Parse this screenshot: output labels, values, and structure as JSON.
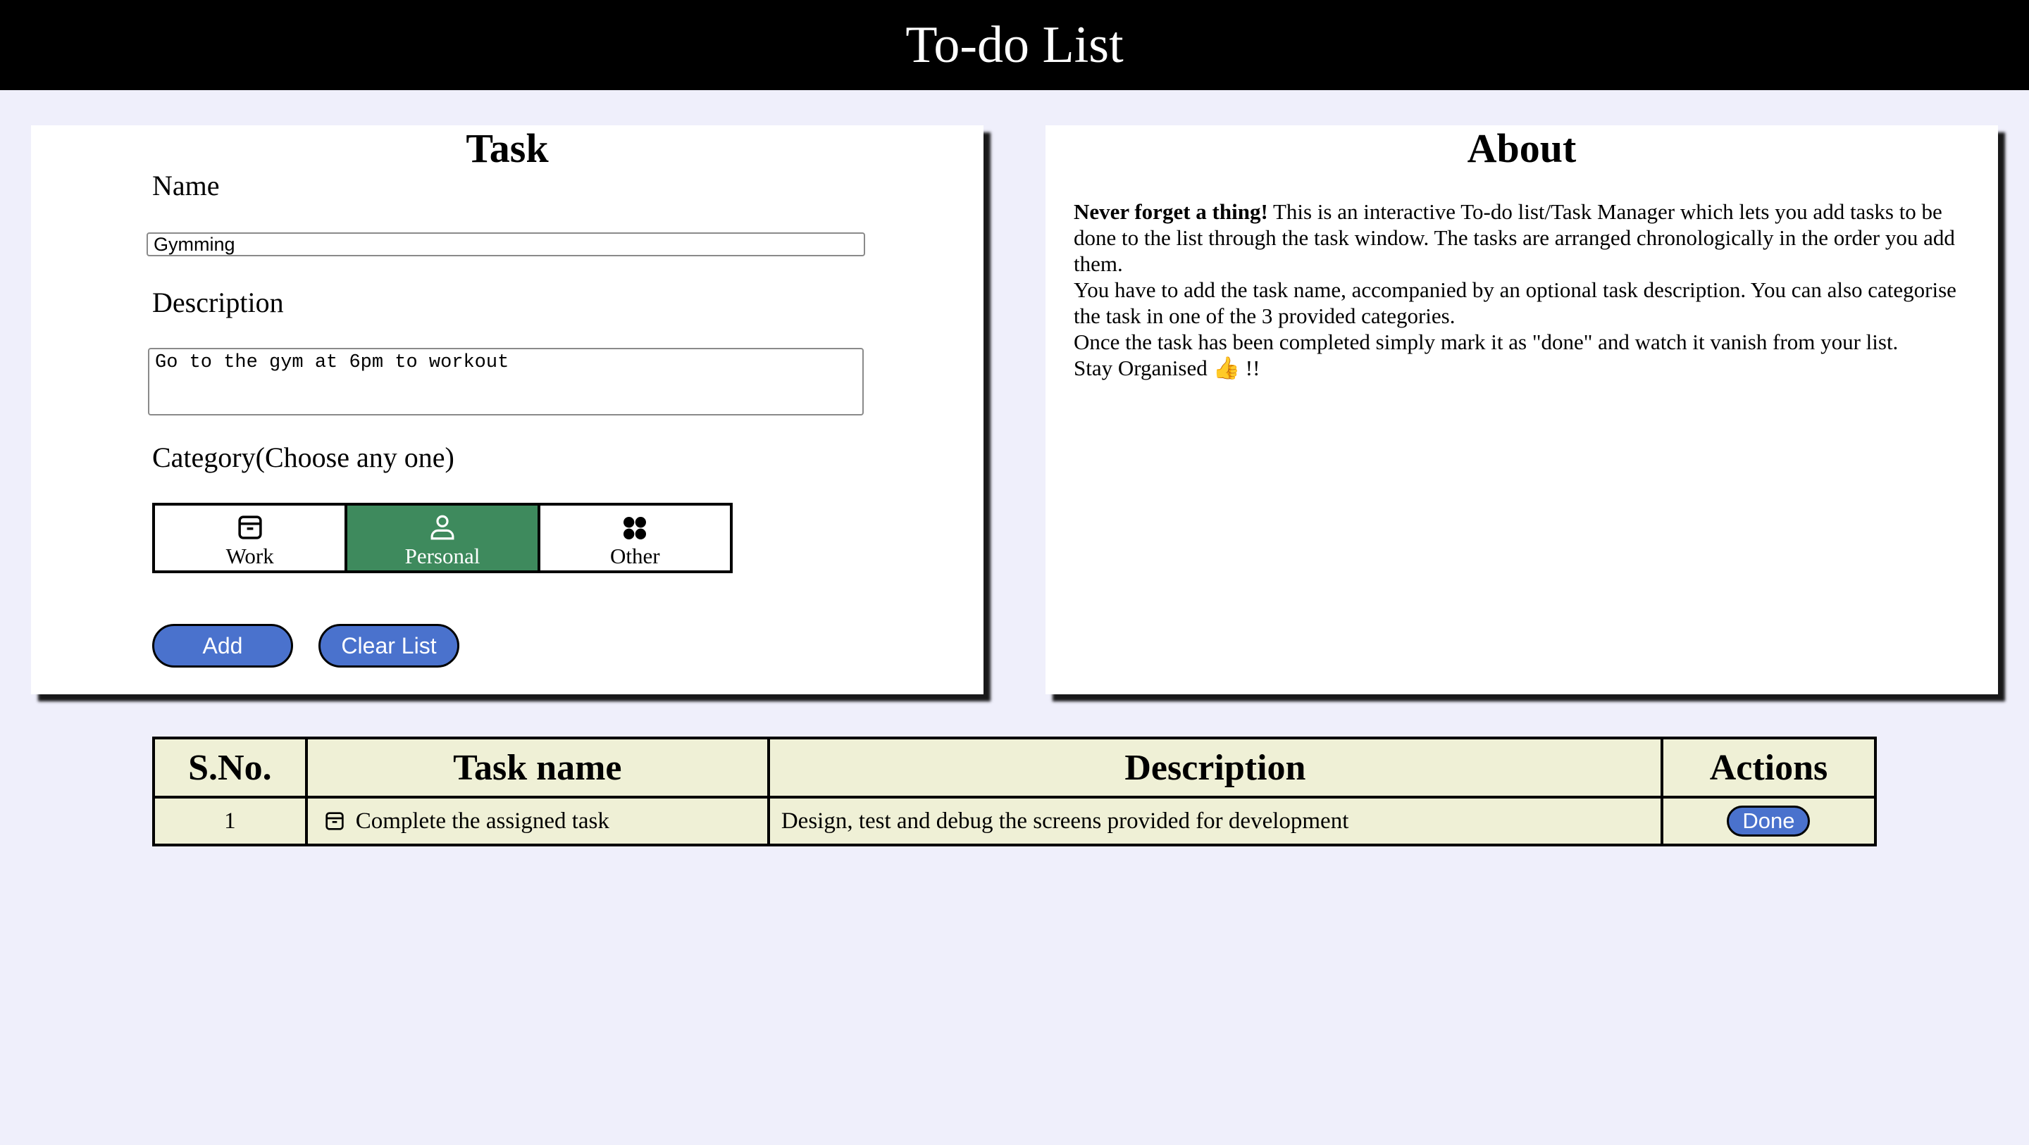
{
  "header": {
    "title": "To-do List"
  },
  "task_panel": {
    "title": "Task",
    "name_label": "Name",
    "name_value": "Gymming",
    "description_label": "Description",
    "description_value": "Go to the gym at 6pm to workout",
    "category_label": "Category(Choose any one)",
    "categories": [
      {
        "label": "Work",
        "icon": "archive-box-icon",
        "selected": false
      },
      {
        "label": "Personal",
        "icon": "person-icon",
        "selected": true
      },
      {
        "label": "Other",
        "icon": "four-circles-icon",
        "selected": false
      }
    ],
    "add_label": "Add",
    "clear_label": "Clear List",
    "colors": {
      "selected_category": "#3e8a5d",
      "button": "#4a72cd"
    }
  },
  "about_panel": {
    "title": "About",
    "lead_bold": "Never forget a thing!",
    "lead_rest": " This is an interactive To-do list/Task Manager which lets you add tasks to be done to the list through the task window. The tasks are arranged chronologically in the order you add them.",
    "para2": "You have to add the task name, accompanied by an optional task description. You can also categorise the task in one of the 3 provided categories.",
    "para3": "Once the task has been completed simply mark it as \"done\" and watch it vanish from your list.",
    "para4": "Stay Organised 👍 !!"
  },
  "table": {
    "headers": [
      "S.No.",
      "Task name",
      "Description",
      "Actions"
    ],
    "rows": [
      {
        "sno": "1",
        "icon": "archive-box-icon",
        "name": "Complete the assigned task",
        "description": "Design, test and debug the screens provided for development",
        "action": "Done"
      }
    ],
    "background": "#eff0d6"
  }
}
